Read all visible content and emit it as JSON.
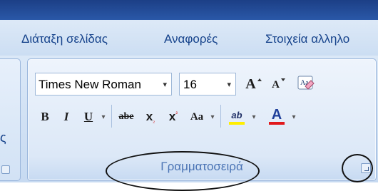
{
  "tabs": [
    {
      "label": "Διάταξη σελίδας"
    },
    {
      "label": "Αναφορές"
    },
    {
      "label": "Στοιχεία αλληλο"
    }
  ],
  "left_group": {
    "label_fragment": "ς"
  },
  "font_group": {
    "label": "Γραμματοσειρά",
    "font_name": "Times New Roman",
    "font_size": "16",
    "dropdown_arrow": "▾",
    "grow_label": "A",
    "shrink_label": "A",
    "clear_formatting_label": "Aa",
    "bold_label": "B",
    "italic_label": "I",
    "underline_label": "U",
    "strike_label": "abe",
    "subscript_label": "x",
    "superscript_label": "x",
    "change_case_label": "Aa",
    "highlight_label": "ab",
    "font_color_label": "A"
  },
  "colors": {
    "highlight": "#ffee00",
    "font_color": "#e1191c",
    "label": "#4b74b5",
    "tab_text": "#15428b"
  }
}
